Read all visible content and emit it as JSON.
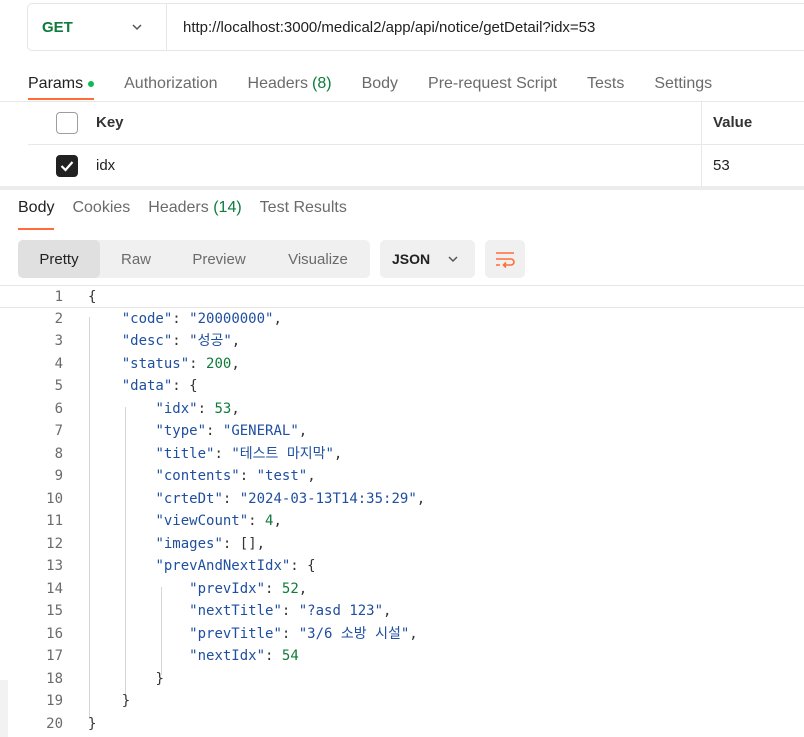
{
  "request": {
    "method": "GET",
    "url": "http://localhost:3000/medical2/app/api/notice/getDetail?idx=53"
  },
  "request_tabs": [
    {
      "label": "Params",
      "count": ""
    },
    {
      "label": "Authorization",
      "count": ""
    },
    {
      "label": "Headers",
      "count": "(8)"
    },
    {
      "label": "Body",
      "count": ""
    },
    {
      "label": "Pre-request Script",
      "count": ""
    },
    {
      "label": "Tests",
      "count": ""
    },
    {
      "label": "Settings",
      "count": ""
    }
  ],
  "params": {
    "header_key": "Key",
    "header_value": "Value",
    "rows": [
      {
        "key": "idx",
        "value": "53",
        "checked": true
      }
    ]
  },
  "response_tabs": [
    {
      "label": "Body",
      "count": ""
    },
    {
      "label": "Cookies",
      "count": ""
    },
    {
      "label": "Headers",
      "count": "(14)"
    },
    {
      "label": "Test Results",
      "count": ""
    }
  ],
  "view_modes": [
    "Pretty",
    "Raw",
    "Preview",
    "Visualize"
  ],
  "format": "JSON",
  "code_lines": [
    "{",
    "    \"code\": \"20000000\",",
    "    \"desc\": \"성공\",",
    "    \"status\": 200,",
    "    \"data\": {",
    "        \"idx\": 53,",
    "        \"type\": \"GENERAL\",",
    "        \"title\": \"테스트 마지막\",",
    "        \"contents\": \"test\",",
    "        \"crteDt\": \"2024-03-13T14:35:29\",",
    "        \"viewCount\": 4,",
    "        \"images\": [],",
    "        \"prevAndNextIdx\": {",
    "            \"prevIdx\": 52,",
    "            \"nextTitle\": \"?asd 123\",",
    "            \"prevTitle\": \"3/6 소방 시설\",",
    "            \"nextIdx\": 54",
    "        }",
    "    }",
    "}"
  ],
  "colors": {
    "accent": "#ff6c37",
    "method_get": "#0f7b3c",
    "json_string": "#1f4fa0",
    "json_number": "#0f7b3c"
  }
}
